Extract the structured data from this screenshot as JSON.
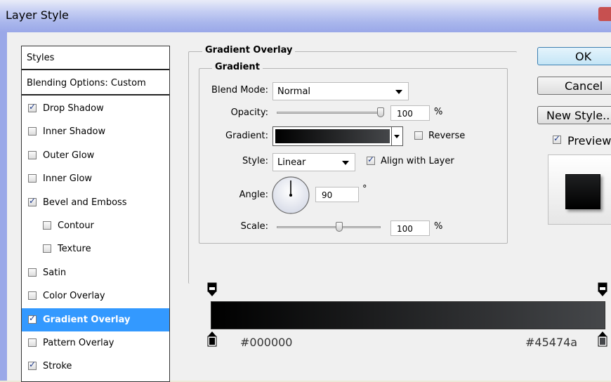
{
  "window": {
    "title": "Layer Style"
  },
  "styles_panel": {
    "header": "Styles",
    "blending_options": "Blending Options: Custom",
    "items": [
      {
        "label": "Drop Shadow",
        "checked": true
      },
      {
        "label": "Inner Shadow",
        "checked": false
      },
      {
        "label": "Outer Glow",
        "checked": false
      },
      {
        "label": "Inner Glow",
        "checked": false
      },
      {
        "label": "Bevel and Emboss",
        "checked": true
      },
      {
        "label": "Contour",
        "checked": false
      },
      {
        "label": "Texture",
        "checked": false
      },
      {
        "label": "Satin",
        "checked": false
      },
      {
        "label": "Color Overlay",
        "checked": false
      },
      {
        "label": "Gradient Overlay",
        "checked": true,
        "selected": true
      },
      {
        "label": "Pattern Overlay",
        "checked": false
      },
      {
        "label": "Stroke",
        "checked": true
      }
    ]
  },
  "gradient_overlay": {
    "section_title": "Gradient Overlay",
    "subsection_title": "Gradient",
    "blend_mode": {
      "label": "Blend Mode:",
      "value": "Normal"
    },
    "opacity": {
      "label": "Opacity:",
      "value": "100",
      "unit": "%",
      "level": 1.0
    },
    "gradient": {
      "label": "Gradient:",
      "reverse_label": "Reverse",
      "reverse_checked": false,
      "start_color": "#000000",
      "end_color": "#45474a"
    },
    "style": {
      "label": "Style:",
      "value": "Linear",
      "align_label": "Align with Layer",
      "align_checked": true
    },
    "angle": {
      "label": "Angle:",
      "value": "90",
      "unit": "°"
    },
    "scale": {
      "label": "Scale:",
      "value": "100",
      "unit": "%",
      "level": 0.6
    }
  },
  "gradient_editor": {
    "start_hex": "#000000",
    "end_hex": "#45474a"
  },
  "buttons": {
    "ok": "OK",
    "cancel": "Cancel",
    "new_style": "New Style...",
    "preview_label": "Preview",
    "preview_checked": true
  },
  "colors": {
    "selection": "#3399ff",
    "title_bar": "#a9b6ec",
    "gradient_start": "#000000",
    "gradient_end": "#45474a"
  }
}
